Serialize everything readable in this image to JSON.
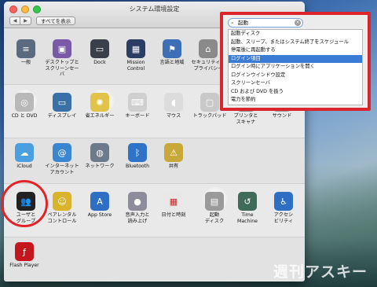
{
  "window": {
    "title": "システム環境設定",
    "back_label": "◀",
    "forward_label": "▶",
    "show_all_label": "すべてを表示"
  },
  "sections": [
    {
      "name": "personal",
      "panes": [
        {
          "id": "general",
          "label": "一般",
          "icon": "general-icon",
          "color": "#5b6b7f"
        },
        {
          "id": "desktop",
          "label": "デスクトップと\nスクリーンセーバ",
          "icon": "desktop-icon",
          "color": "#7a5aa6"
        },
        {
          "id": "dock",
          "label": "Dock",
          "icon": "dock-icon",
          "color": "#3a3f4a"
        },
        {
          "id": "mission-control",
          "label": "Mission\nControl",
          "icon": "mission-control-icon",
          "color": "#2c3d63"
        },
        {
          "id": "language",
          "label": "言語と地域",
          "icon": "flag-icon",
          "color": "#3c6fb6"
        },
        {
          "id": "security",
          "label": "セキュリティと\nプライバシー",
          "icon": "house-icon",
          "color": "#8a8a8a"
        }
      ]
    },
    {
      "name": "hardware",
      "panes": [
        {
          "id": "cd-dvd",
          "label": "CD と DVD",
          "icon": "disc-icon",
          "color": "#b8b8b8"
        },
        {
          "id": "displays",
          "label": "ディスプレイ",
          "icon": "display-icon",
          "color": "#3a6fa8"
        },
        {
          "id": "energy",
          "label": "省エネルギー",
          "icon": "bulb-icon",
          "color": "#e2c34a"
        },
        {
          "id": "keyboard",
          "label": "キーボード",
          "icon": "keyboard-icon",
          "color": "#cfcfcf"
        },
        {
          "id": "mouse",
          "label": "マウス",
          "icon": "mouse-icon",
          "color": "#dcdcdc"
        },
        {
          "id": "trackpad",
          "label": "トラックパッド",
          "icon": "trackpad-icon",
          "color": "#c9c9c9"
        },
        {
          "id": "printers",
          "label": "プリンタと\nスキャナ",
          "icon": "printer-icon",
          "color": "#8f8f8f"
        },
        {
          "id": "sound",
          "label": "サウンド",
          "icon": "speaker-icon",
          "color": "#9a9a9a"
        }
      ]
    },
    {
      "name": "internet",
      "panes": [
        {
          "id": "icloud",
          "label": "iCloud",
          "icon": "cloud-icon",
          "color": "#4a9fe0"
        },
        {
          "id": "internet-accounts",
          "label": "インターネット\nアカウント",
          "icon": "at-icon",
          "color": "#3b86d1"
        },
        {
          "id": "network",
          "label": "ネットワーク",
          "icon": "globe-icon",
          "color": "#6d7a8c"
        },
        {
          "id": "bluetooth",
          "label": "Bluetooth",
          "icon": "bluetooth-icon",
          "color": "#2f73c9"
        },
        {
          "id": "sharing",
          "label": "共有",
          "icon": "sharing-folder-icon",
          "color": "#c9a83a"
        }
      ]
    },
    {
      "name": "system",
      "panes": [
        {
          "id": "users",
          "label": "ユーザと\nグループ",
          "icon": "users-icon",
          "color": "#222222"
        },
        {
          "id": "parental",
          "label": "ペアレンタル\nコントロール",
          "icon": "parental-icon",
          "color": "#d9b32c"
        },
        {
          "id": "app-store",
          "label": "App Store",
          "icon": "app-store-icon",
          "color": "#2e6fc4"
        },
        {
          "id": "dictation",
          "label": "音声入力と\n読み上げ",
          "icon": "microphone-icon",
          "color": "#8c8c9a"
        },
        {
          "id": "date-time",
          "label": "日付と時刻",
          "icon": "calendar-icon",
          "color": "#e8e8e8"
        },
        {
          "id": "startup-disk",
          "label": "起動\nディスク",
          "icon": "disk-icon",
          "color": "#9a9a9a"
        },
        {
          "id": "time-machine",
          "label": "Time\nMachine",
          "icon": "time-machine-icon",
          "color": "#3f6b5a"
        },
        {
          "id": "accessibility",
          "label": "アクセシ\nビリティ",
          "icon": "accessibility-icon",
          "color": "#2e6fc4"
        }
      ]
    },
    {
      "name": "other",
      "panes": [
        {
          "id": "flash",
          "label": "Flash Player",
          "icon": "flash-icon",
          "color": "#c4171d"
        }
      ]
    }
  ],
  "search": {
    "value": "起動",
    "results": [
      {
        "label": "起動ディスク",
        "selected": false
      },
      {
        "label": "起動、スリープ、またはシステム終了をスケジュール",
        "selected": false
      },
      {
        "label": "停電後に再起動する",
        "selected": false
      },
      {
        "label": "ログイン項目",
        "selected": true
      },
      {
        "label": "ログイン時にアプリケーションを開く",
        "selected": false
      },
      {
        "label": "ログインウインドウ設定",
        "selected": false
      },
      {
        "label": "スクリーンセーバ",
        "selected": false
      },
      {
        "label": "CD および DVD を扱う",
        "selected": false
      },
      {
        "label": "電力を節約",
        "selected": false
      }
    ]
  },
  "watermark": "週刊アスキー",
  "colors": {
    "highlight": "#e0242a",
    "selection": "#3a7bd5"
  }
}
